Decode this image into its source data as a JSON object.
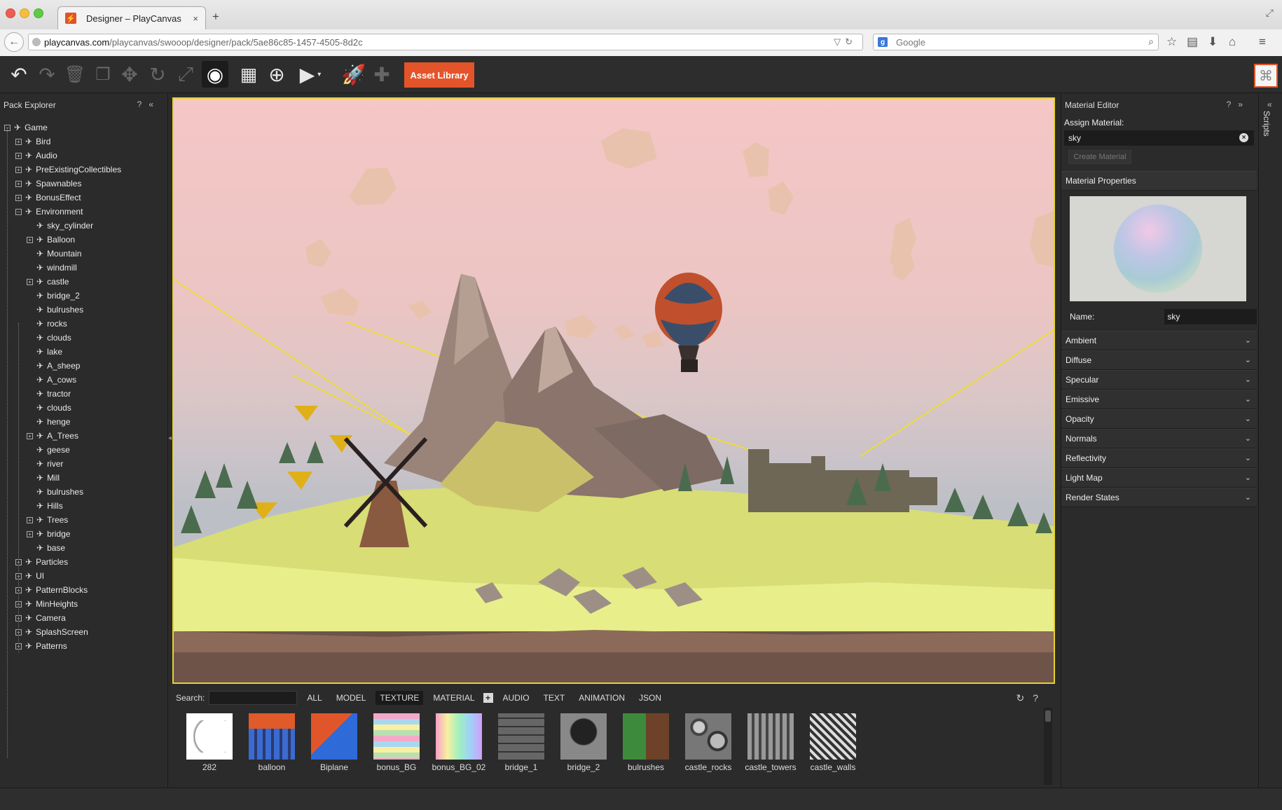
{
  "browser": {
    "tab_title": "Designer – PlayCanvas",
    "url_domain": "playcanvas.com",
    "url_path": "/playcanvas/swooop/designer/pack/5ae86c85-1457-4505-8d2c",
    "search_placeholder": "Google"
  },
  "toolbar": {
    "asset_library_label": "Asset Library"
  },
  "pack_explorer": {
    "title": "Pack Explorer",
    "help": "?",
    "collapse": "«",
    "nodes": [
      {
        "label": "Game",
        "depth": 0,
        "expander": "−"
      },
      {
        "label": "Bird",
        "depth": 1,
        "expander": "+"
      },
      {
        "label": "Audio",
        "depth": 1,
        "expander": "+"
      },
      {
        "label": "PreExistingCollectibles",
        "depth": 1,
        "expander": "+"
      },
      {
        "label": "Spawnables",
        "depth": 1,
        "expander": "+"
      },
      {
        "label": "BonusEffect",
        "depth": 1,
        "expander": "+"
      },
      {
        "label": "Environment",
        "depth": 1,
        "expander": "−"
      },
      {
        "label": "sky_cylinder",
        "depth": 2,
        "expander": ""
      },
      {
        "label": "Balloon",
        "depth": 2,
        "expander": "+"
      },
      {
        "label": "Mountain",
        "depth": 2,
        "expander": ""
      },
      {
        "label": "windmill",
        "depth": 2,
        "expander": ""
      },
      {
        "label": "castle",
        "depth": 2,
        "expander": "+"
      },
      {
        "label": "bridge_2",
        "depth": 2,
        "expander": ""
      },
      {
        "label": "bulrushes",
        "depth": 2,
        "expander": ""
      },
      {
        "label": "rocks",
        "depth": 2,
        "expander": ""
      },
      {
        "label": "clouds",
        "depth": 2,
        "expander": ""
      },
      {
        "label": "lake",
        "depth": 2,
        "expander": ""
      },
      {
        "label": "A_sheep",
        "depth": 2,
        "expander": ""
      },
      {
        "label": "A_cows",
        "depth": 2,
        "expander": ""
      },
      {
        "label": "tractor",
        "depth": 2,
        "expander": ""
      },
      {
        "label": "clouds",
        "depth": 2,
        "expander": ""
      },
      {
        "label": "henge",
        "depth": 2,
        "expander": ""
      },
      {
        "label": "A_Trees",
        "depth": 2,
        "expander": "+"
      },
      {
        "label": "geese",
        "depth": 2,
        "expander": ""
      },
      {
        "label": "river",
        "depth": 2,
        "expander": ""
      },
      {
        "label": "Mill",
        "depth": 2,
        "expander": ""
      },
      {
        "label": "bulrushes",
        "depth": 2,
        "expander": ""
      },
      {
        "label": "Hills",
        "depth": 2,
        "expander": ""
      },
      {
        "label": "Trees",
        "depth": 2,
        "expander": "+"
      },
      {
        "label": "bridge",
        "depth": 2,
        "expander": "+"
      },
      {
        "label": "base",
        "depth": 2,
        "expander": ""
      },
      {
        "label": "Particles",
        "depth": 1,
        "expander": "+"
      },
      {
        "label": "UI",
        "depth": 1,
        "expander": "+"
      },
      {
        "label": "PatternBlocks",
        "depth": 1,
        "expander": "+"
      },
      {
        "label": "MinHeights",
        "depth": 1,
        "expander": "+"
      },
      {
        "label": "Camera",
        "depth": 1,
        "expander": "+"
      },
      {
        "label": "SplashScreen",
        "depth": 1,
        "expander": "+"
      },
      {
        "label": "Patterns",
        "depth": 1,
        "expander": "+"
      }
    ]
  },
  "asset_panel": {
    "search_label": "Search:",
    "filters": [
      "ALL",
      "MODEL",
      "TEXTURE",
      "MATERIAL"
    ],
    "filters_after": [
      "AUDIO",
      "TEXT",
      "ANIMATION",
      "JSON"
    ],
    "active_filter": "TEXTURE",
    "help": "?",
    "assets": [
      {
        "name": "282",
        "kind": "ring"
      },
      {
        "name": "balloon",
        "kind": "balloon"
      },
      {
        "name": "Biplane",
        "kind": "biplane"
      },
      {
        "name": "bonus_BG",
        "kind": "stripes"
      },
      {
        "name": "bonus_BG_02",
        "kind": "rainbow"
      },
      {
        "name": "bridge_1",
        "kind": "stone"
      },
      {
        "name": "bridge_2",
        "kind": "stone2"
      },
      {
        "name": "bulrushes",
        "kind": "greenbrown"
      },
      {
        "name": "castle_rocks",
        "kind": "rocks"
      },
      {
        "name": "castle_towers",
        "kind": "towers"
      },
      {
        "name": "castle_walls",
        "kind": "walls"
      }
    ]
  },
  "material_editor": {
    "title": "Material Editor",
    "help": "?",
    "collapse": "»",
    "assign_label": "Assign Material:",
    "assign_value": "sky",
    "create_button": "Create Material",
    "properties_title": "Material Properties",
    "name_label": "Name:",
    "name_value": "sky",
    "sections": [
      "Ambient",
      "Diffuse",
      "Specular",
      "Emissive",
      "Opacity",
      "Normals",
      "Reflectivity",
      "Light Map",
      "Render States"
    ]
  },
  "scripts_panel": {
    "collapse": "«",
    "label": "Scripts"
  }
}
